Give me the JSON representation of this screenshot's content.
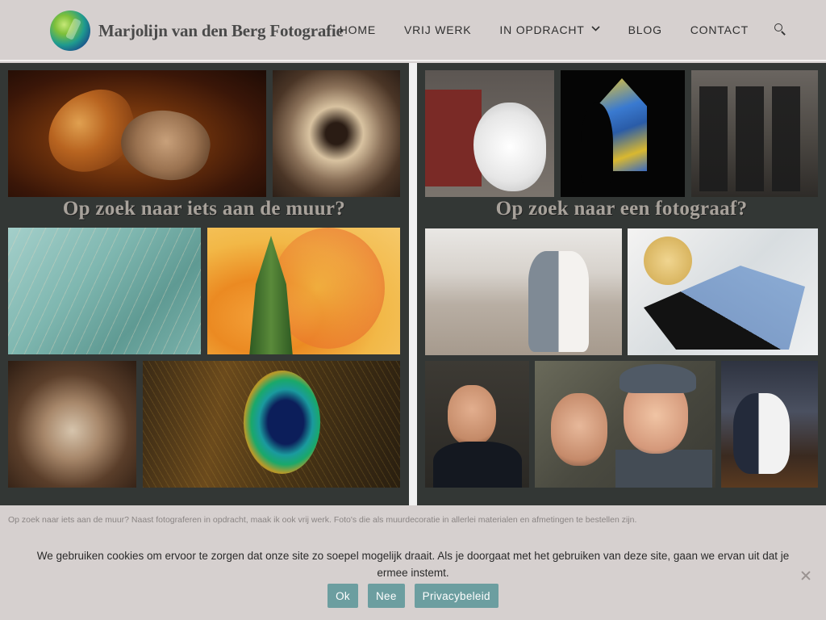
{
  "header": {
    "logo_text": "Marjolijn van den Berg Fotografie",
    "nav": {
      "home": "HOME",
      "vrij_werk": "VRIJ WERK",
      "in_opdracht": "IN OPDRACHT",
      "blog": "BLOG",
      "contact": "CONTACT"
    },
    "icons": {
      "search": "search-icon",
      "dropdown": "chevron-down-icon"
    }
  },
  "panels": {
    "left": {
      "caption": "Op zoek naar iets aan de muur?"
    },
    "right": {
      "caption": "Op zoek naar een fotograaf?"
    }
  },
  "intro_text": "Op zoek naar iets aan de muur? Naast fotograferen in opdracht, maak ik ook vrij werk. Foto's die als muurdecoratie in allerlei materialen en afmetingen te bestellen zijn.",
  "cookie_notice": {
    "text": "We gebruiken cookies om ervoor te zorgen dat onze site zo soepel mogelijk draait. Als je doorgaat met het gebruiken van deze site, gaan we ervan uit dat je ermee instemt.",
    "buttons": {
      "ok": "Ok",
      "nee": "Nee",
      "privacy": "Privacybeleid"
    },
    "close_icon": "close-icon"
  },
  "colors": {
    "header_bg": "#d6d0cf",
    "panel_bg": "#333735",
    "button_bg": "#6c9ea0",
    "caption_text": "#a8a29b"
  }
}
